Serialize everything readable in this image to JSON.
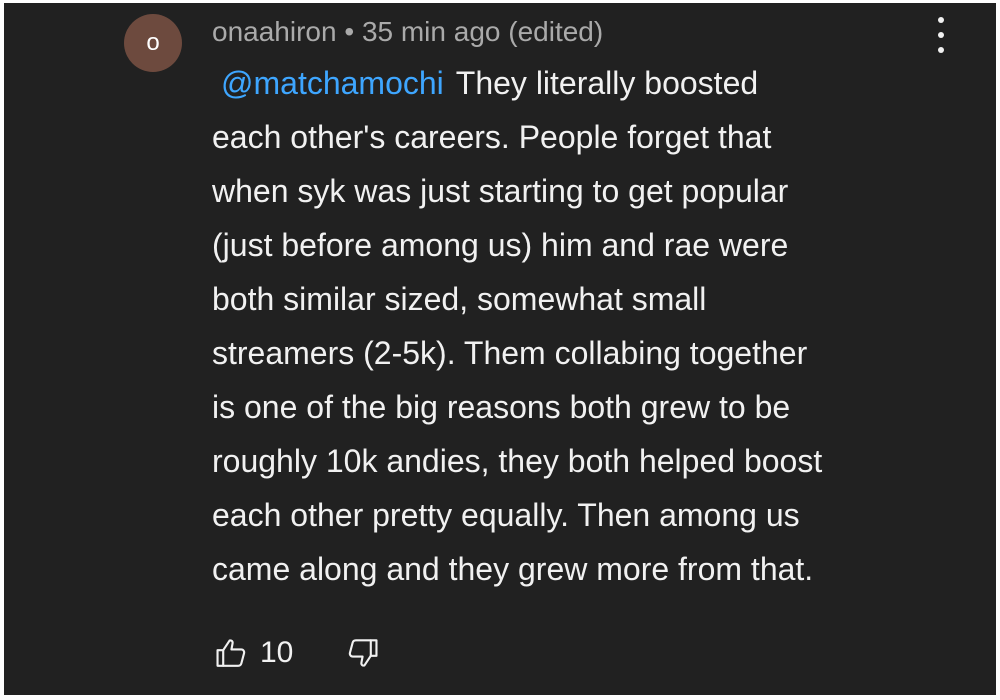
{
  "comment": {
    "avatar_letter": "o",
    "author": "onaahiron",
    "separator": "•",
    "time": "35 min ago",
    "edited": "(edited)",
    "mention": "@matchamochi",
    "text": "They literally boosted\neach other's careers. People forget that\nwhen syk was just starting to get popular\n(just before among us) him and rae were\nboth similar sized, somewhat small\nstreamers (2-5k). Them collabing together\nis one of the big reasons both grew to be\nroughly 10k andies, they both helped boost\neach other pretty equally. Then among us\ncame along and they grew more from that.",
    "likes": "10"
  },
  "icons": {
    "menu": "more-vert-icon",
    "like": "thumb-up-icon",
    "dislike": "thumb-down-icon"
  },
  "colors": {
    "background": "#212121",
    "text": "#f1f1f1",
    "meta": "#aaaaaa",
    "mention": "#3ea6ff",
    "avatar": "#6d4a3e"
  }
}
